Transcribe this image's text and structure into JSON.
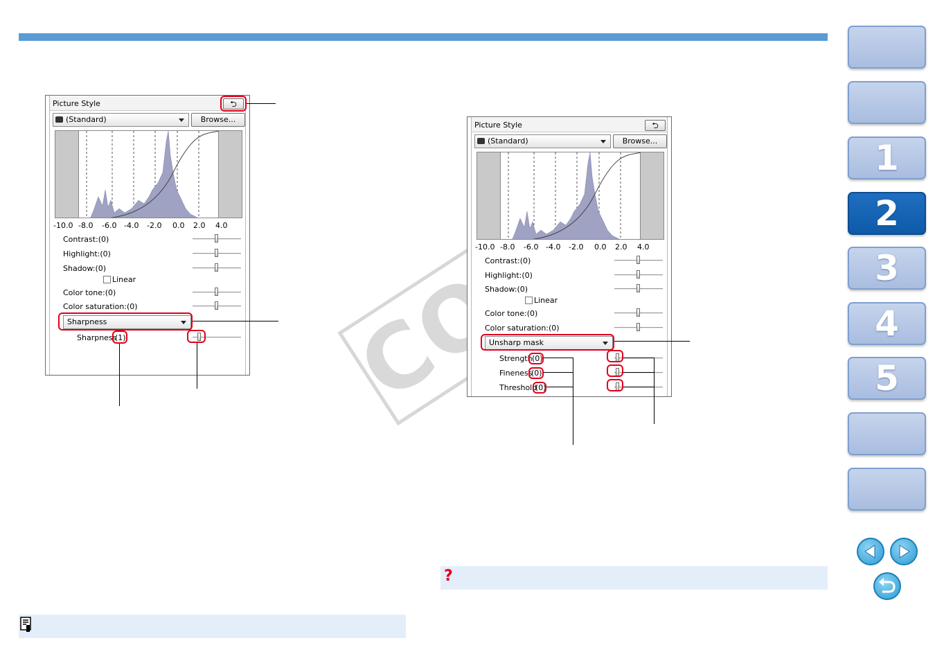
{
  "nav": {
    "tabs": [
      "",
      "",
      "1",
      "2",
      "3",
      "4",
      "5",
      "",
      ""
    ],
    "active_tab": "2"
  },
  "watermark": "COPY",
  "panel_left": {
    "title": "Picture Style",
    "style_value": "(Standard)",
    "browse_label": "Browse...",
    "ticks": [
      "-10.0",
      "-8.0",
      "-6.0",
      "-4.0",
      "-2.0",
      "0.0",
      "2.0",
      "4.0"
    ],
    "contrast": "Contrast:(0)",
    "highlight": "Highlight:(0)",
    "shadow": "Shadow:(0)",
    "linear": "Linear",
    "color_tone": "Color tone:(0)",
    "color_saturation": "Color saturation:(0)",
    "sharp_mode": "Sharpness",
    "sharpness_label": "Sharpness",
    "sharpness_value": "(1)"
  },
  "panel_right": {
    "title": "Picture Style",
    "style_value": "(Standard)",
    "browse_label": "Browse...",
    "ticks": [
      "-10.0",
      "-8.0",
      "-6.0",
      "-4.0",
      "-2.0",
      "0.0",
      "2.0",
      "4.0"
    ],
    "contrast": "Contrast:(0)",
    "highlight": "Highlight:(0)",
    "shadow": "Shadow:(0)",
    "linear": "Linear",
    "color_tone": "Color tone:(0)",
    "color_saturation": "Color saturation:(0)",
    "sharp_mode": "Unsharp mask",
    "strength_label": "Strength",
    "strength_value": "(0)",
    "fineness_label": "Fineness",
    "fineness_value": "(0)",
    "threshold_label": "Threshold",
    "threshold_value": "(0)"
  },
  "colors": {
    "accent": "#5b9bd5",
    "highlight_box": "#e0001b",
    "active_tab": "#0d5aa8"
  }
}
